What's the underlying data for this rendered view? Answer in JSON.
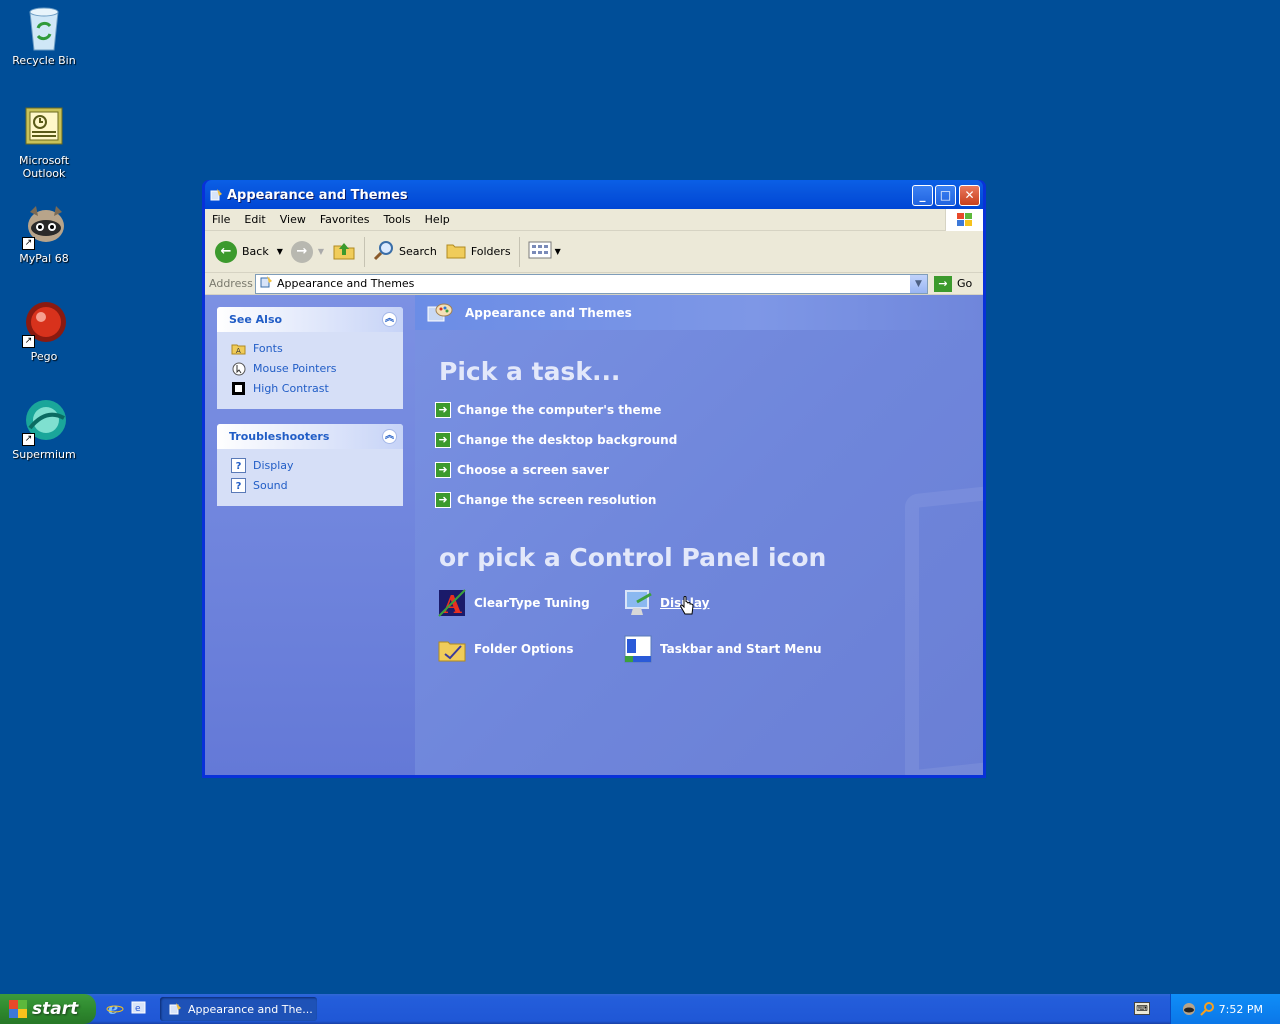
{
  "desktop": {
    "icons": [
      {
        "label": "Recycle Bin"
      },
      {
        "label": "Microsoft Outlook"
      },
      {
        "label": "MyPal 68"
      },
      {
        "label": "Pego"
      },
      {
        "label": "Supermium"
      }
    ]
  },
  "window": {
    "title": "Appearance and Themes",
    "menu": [
      "File",
      "Edit",
      "View",
      "Favorites",
      "Tools",
      "Help"
    ],
    "toolbar": {
      "back": "Back",
      "search": "Search",
      "folders": "Folders"
    },
    "address": {
      "label": "Address",
      "value": "Appearance and Themes",
      "go": "Go"
    },
    "see_also": {
      "title": "See Also",
      "items": [
        {
          "label": "Fonts",
          "icon": "folder-fonts-icon"
        },
        {
          "label": "Mouse Pointers",
          "icon": "mouse-pointer-icon"
        },
        {
          "label": "High Contrast",
          "icon": "high-contrast-icon"
        }
      ]
    },
    "troubleshooters": {
      "title": "Troubleshooters",
      "items": [
        {
          "label": "Display",
          "icon": "help-icon"
        },
        {
          "label": "Sound",
          "icon": "help-icon"
        }
      ]
    },
    "main": {
      "header": "Appearance and Themes",
      "pick_task": "Pick a task...",
      "tasks": [
        "Change the computer's theme",
        "Change the desktop background",
        "Choose a screen saver",
        "Change the screen resolution"
      ],
      "pick_icon": "or pick a Control Panel icon",
      "icons": [
        {
          "label": "ClearType Tuning"
        },
        {
          "label": "Display"
        },
        {
          "label": "Folder Options"
        },
        {
          "label": "Taskbar and Start Menu"
        }
      ]
    }
  },
  "taskbar": {
    "start_label": "start",
    "task_button": "Appearance and The...",
    "clock": "7:52 PM"
  },
  "colors": {
    "desktop": "#004e98",
    "link": "#215dc6",
    "start_green": "#3c9b3c",
    "title_blue": "#0a5fe6"
  }
}
